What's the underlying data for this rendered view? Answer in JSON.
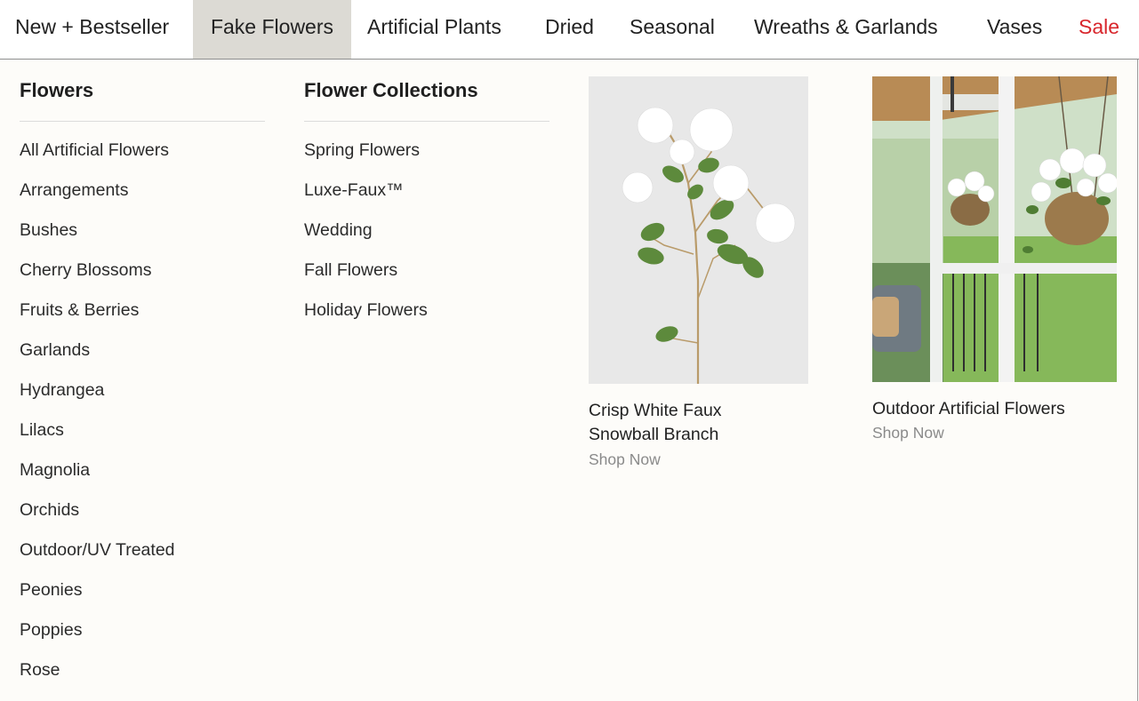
{
  "nav": {
    "items": [
      {
        "label": "New + Bestseller"
      },
      {
        "label": "Fake Flowers"
      },
      {
        "label": "Artificial Plants"
      },
      {
        "label": "Dried"
      },
      {
        "label": "Seasonal"
      },
      {
        "label": "Wreaths & Garlands"
      },
      {
        "label": "Vases"
      },
      {
        "label": "Sale"
      }
    ],
    "active": "Fake Flowers",
    "sale_color": "#d8262c"
  },
  "flowers": {
    "heading": "Flowers",
    "items": [
      "All Artificial Flowers",
      "Arrangements",
      "Bushes",
      "Cherry Blossoms",
      "Fruits & Berries",
      "Garlands",
      "Hydrangea",
      "Lilacs",
      "Magnolia",
      "Orchids",
      "Outdoor/UV Treated",
      "Peonies",
      "Poppies",
      "Rose"
    ]
  },
  "collections": {
    "heading": "Flower Collections",
    "items": [
      "Spring Flowers",
      "Luxe-Faux™",
      "Wedding",
      "Fall Flowers",
      "Holiday Flowers"
    ]
  },
  "promos": [
    {
      "title_line1": "Crisp White Faux",
      "title_line2": "Snowball Branch",
      "cta": "Shop Now",
      "image_icon": "white-snowball-branch-photo"
    },
    {
      "title_line1": "Outdoor Artificial Flowers",
      "cta": "Shop Now",
      "image_icon": "porch-hanging-baskets-photo"
    }
  ]
}
